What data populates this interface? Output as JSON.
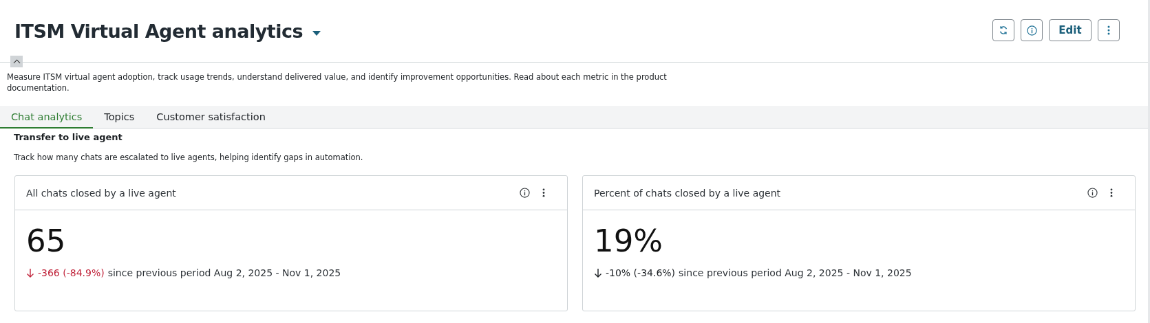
{
  "header": {
    "title": "ITSM Virtual Agent analytics",
    "actions": [
      {
        "kind": "refresh"
      },
      {
        "kind": "info"
      },
      {
        "kind": "text",
        "label": "Edit"
      },
      {
        "kind": "more"
      }
    ]
  },
  "description": "Measure ITSM virtual agent adoption, track usage trends, understand delivered value, and identify improvement opportunities. Read about each metric in the product documentation.",
  "tabs": [
    {
      "label": "Chat analytics",
      "selected": true
    },
    {
      "label": "Topics",
      "selected": false
    },
    {
      "label": "Customer satisfaction",
      "selected": false
    }
  ],
  "section": {
    "title": "Transfer to live agent",
    "subtitle": "Track how many chats are escalated to live agents, helping identify gaps in automation."
  },
  "cards": [
    {
      "title": "All chats closed by a live agent",
      "value": "65",
      "change": "-366 (-84.9%)",
      "color": "#c0233a",
      "period": "since previous period Aug 2, 2025 - Nov 1, 2025"
    },
    {
      "title": "Percent of chats closed by a live agent",
      "value": "19%",
      "change": "-10% (-34.6%)",
      "color": "#1b1f23",
      "period": "since previous period Aug 2, 2025 - Nov 1, 2025"
    }
  ]
}
